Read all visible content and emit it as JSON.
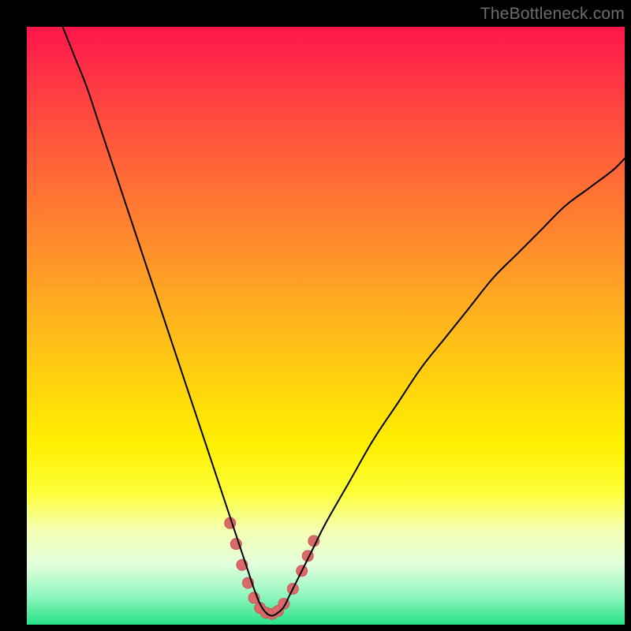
{
  "watermark": "TheBottleneck.com",
  "colors": {
    "curve": "#000000",
    "marker": "#da6a6a",
    "marker_stroke": "#c95a5a"
  },
  "chart_data": {
    "type": "line",
    "title": "",
    "xlabel": "",
    "ylabel": "",
    "xlim": [
      0,
      100
    ],
    "ylim": [
      0,
      100
    ],
    "series": [
      {
        "name": "bottleneck-curve",
        "x": [
          6,
          8,
          10,
          12,
          14,
          16,
          18,
          20,
          22,
          24,
          26,
          28,
          30,
          32,
          34,
          36,
          37,
          38,
          39,
          40,
          41,
          42,
          43,
          44,
          46,
          48,
          50,
          54,
          58,
          62,
          66,
          70,
          74,
          78,
          82,
          86,
          90,
          94,
          98,
          100
        ],
        "y": [
          100,
          95,
          90,
          84,
          78,
          72,
          66,
          60,
          54,
          48,
          42,
          36,
          30,
          24,
          18,
          12,
          9,
          6,
          3.5,
          2,
          1.5,
          2,
          3,
          5,
          9,
          13,
          17,
          24,
          31,
          37,
          43,
          48,
          53,
          58,
          62,
          66,
          70,
          73,
          76,
          78
        ]
      }
    ],
    "markers": {
      "name": "highlight-dots",
      "points": [
        {
          "x": 34.0,
          "y": 17.0
        },
        {
          "x": 35.0,
          "y": 13.5
        },
        {
          "x": 36.0,
          "y": 10.0
        },
        {
          "x": 37.0,
          "y": 7.0
        },
        {
          "x": 38.0,
          "y": 4.5
        },
        {
          "x": 39.0,
          "y": 2.8
        },
        {
          "x": 40.0,
          "y": 2.0
        },
        {
          "x": 41.0,
          "y": 1.8
        },
        {
          "x": 42.0,
          "y": 2.3
        },
        {
          "x": 43.0,
          "y": 3.5
        },
        {
          "x": 44.5,
          "y": 6.0
        },
        {
          "x": 46.0,
          "y": 9.0
        },
        {
          "x": 47.0,
          "y": 11.5
        },
        {
          "x": 48.0,
          "y": 14.0
        }
      ],
      "radius": 7
    }
  }
}
